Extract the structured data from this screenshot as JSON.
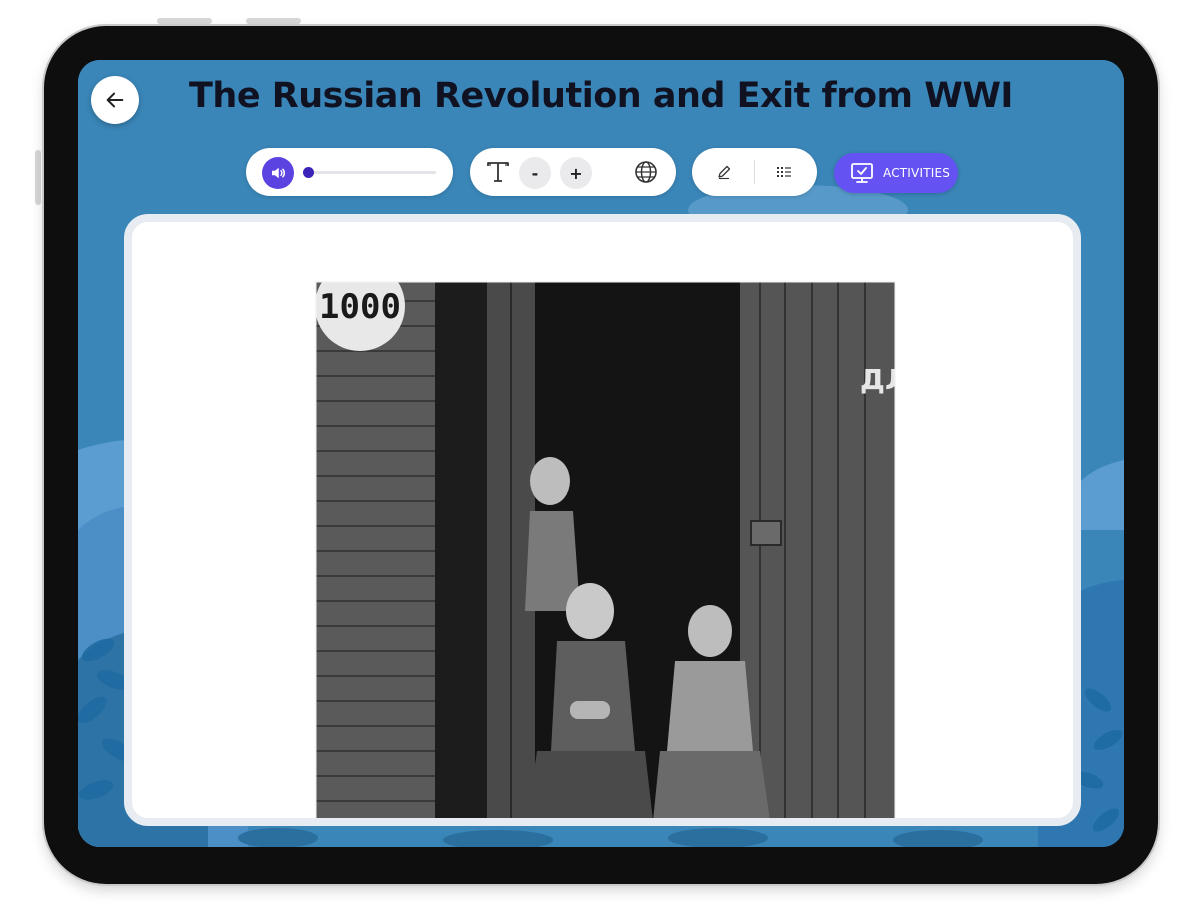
{
  "page": {
    "title": "The Russian Revolution and Exit from WWI"
  },
  "toolbar": {
    "audio": {
      "progress": 0.0,
      "icon": "speaker-icon"
    },
    "text_tools": {
      "decrease_label": "-",
      "increase_label": "+",
      "icons": [
        "text-size-icon",
        "globe-icon"
      ]
    },
    "note_tools": {
      "icons": [
        "pencil-icon",
        "list-icon"
      ]
    },
    "activities_label": "ACTIVITIES"
  },
  "photo": {
    "sign_text": "1000",
    "door_text": "ДЛ",
    "description_icon": "historical-photo"
  },
  "colors": {
    "screen_background": "#3a86b8",
    "accent": "#6452f2",
    "audio_button": "#5a43e0",
    "title_text": "#101221"
  }
}
